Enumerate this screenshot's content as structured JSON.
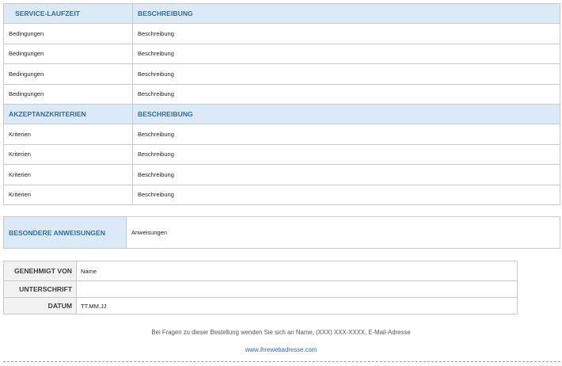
{
  "service_table": {
    "header": [
      "SERVICE-LAUFZEIT",
      "BESCHREIBUNG"
    ],
    "rows": [
      [
        "Bedingungen",
        "Beschreibung"
      ],
      [
        "Bedingungen",
        "Beschreibung"
      ],
      [
        "Bedingungen",
        "Beschreibung"
      ],
      [
        "Bedingungen",
        "Beschreibung"
      ]
    ]
  },
  "acceptance_table": {
    "header": [
      "AKZEPTANZKRITERIEN",
      "BESCHREIBUNG"
    ],
    "rows": [
      [
        "Kriterien",
        "Beschreibung"
      ],
      [
        "Kriterien",
        "Beschreibung"
      ],
      [
        "Kriterien",
        "Beschreibung"
      ],
      [
        "Kriterien",
        "Beschreibung"
      ]
    ]
  },
  "special_instructions": {
    "label": "BESONDERE ANWEISUNGEN",
    "value": "Anweisungen"
  },
  "approval": {
    "approved_by_label": "GENEHMIGT VON",
    "approved_by_value": "Name",
    "signature_label": "UNTERSCHRIFT",
    "signature_value": "",
    "date_label": "DATUM",
    "date_value": "TT.MM.JJ"
  },
  "footer": {
    "contact_text": "Bei Fragen zu dieser Bestellung wenden Sie sich an Name, (XXX) XXX-XXXX, E-Mail-Adresse",
    "website": "www.ihrewebadresse.com"
  },
  "colors": {
    "header_bg": "#dceaf7",
    "header_text": "#2e6ca6",
    "label_bg": "#f2f2f2",
    "border": "#c9c9c9"
  }
}
